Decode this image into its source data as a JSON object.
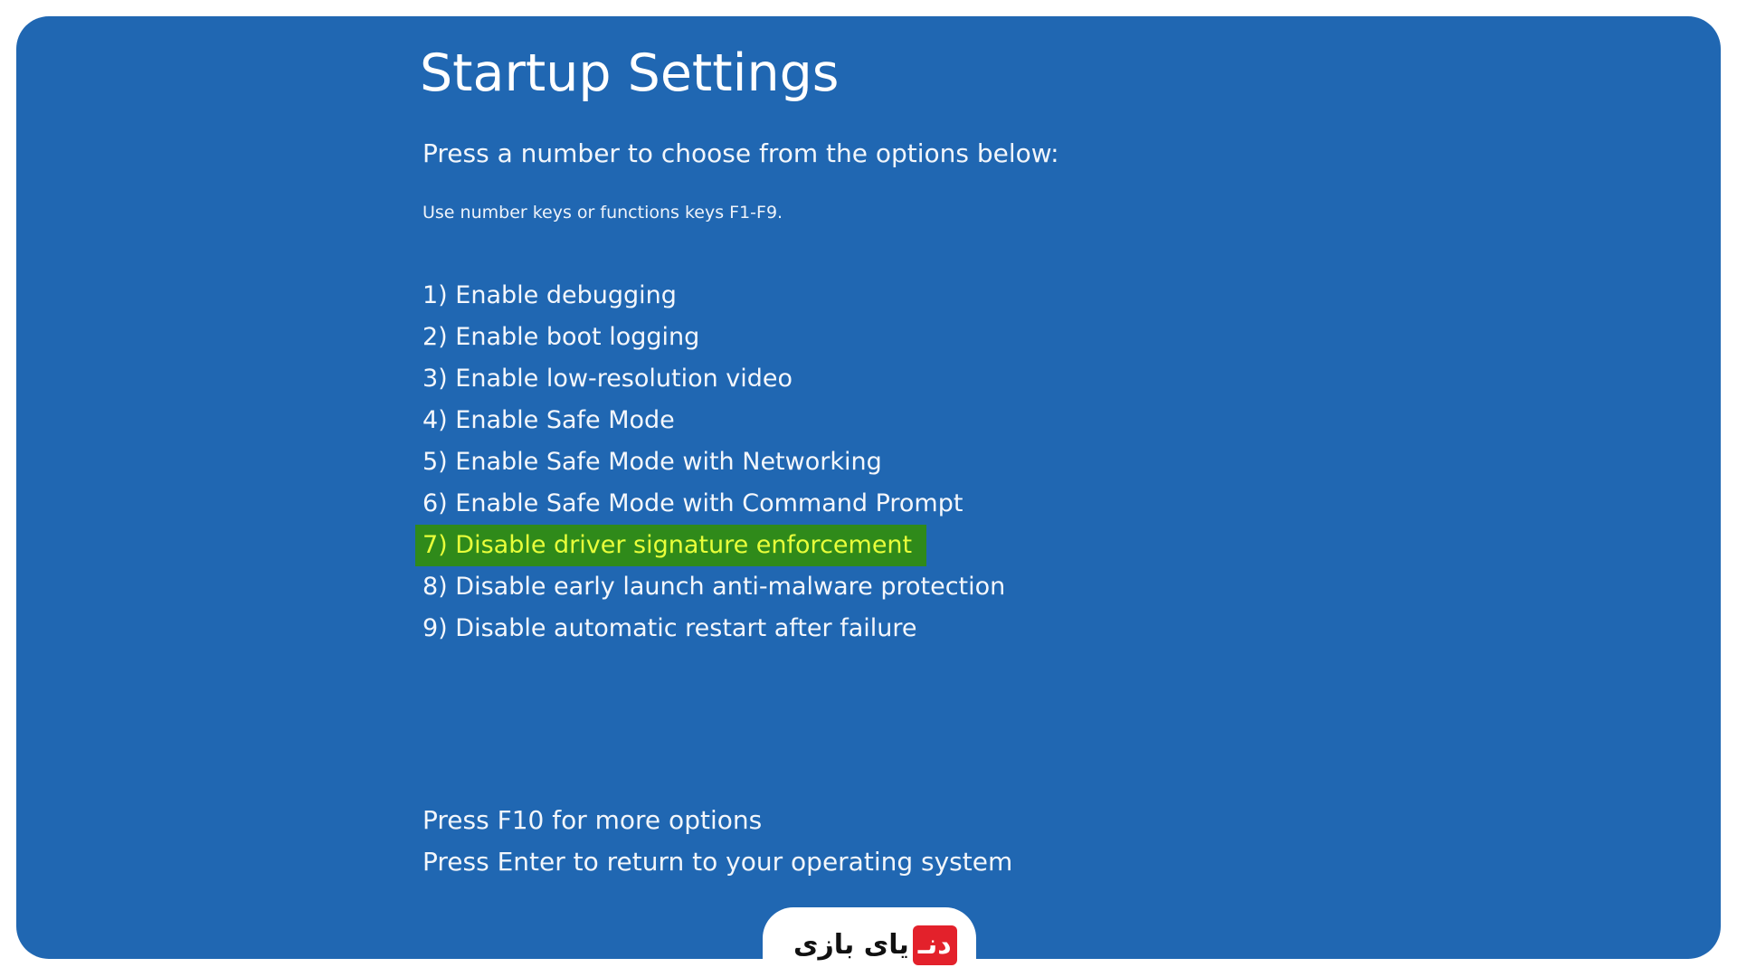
{
  "screen": {
    "title": "Startup Settings",
    "subtitle": "Press a number to choose from the options below:",
    "hint": "Use number keys or functions keys F1-F9.",
    "options": [
      {
        "label": "1) Enable debugging"
      },
      {
        "label": "2) Enable boot logging"
      },
      {
        "label": "3) Enable low-resolution video"
      },
      {
        "label": "4) Enable Safe Mode"
      },
      {
        "label": "5) Enable Safe Mode with Networking"
      },
      {
        "label": "6) Enable Safe Mode with Command Prompt"
      },
      {
        "label": "7) Disable driver signature enforcement",
        "highlighted": true
      },
      {
        "label": "8) Disable early launch anti-malware protection"
      },
      {
        "label": "9) Disable automatic restart after failure"
      }
    ],
    "footer": {
      "more_options": "Press F10 for more options",
      "return": "Press Enter to return to your operating system"
    }
  },
  "watermark": {
    "brand_red": "دنـ",
    "brand_black": "یای بازی",
    "colors": {
      "red": "#e3212b",
      "black": "#111111"
    }
  },
  "colors": {
    "background": "#2067b2",
    "text": "#ffffff",
    "highlight_bg": "#2f8a1a",
    "highlight_text": "#e8ff3a"
  }
}
